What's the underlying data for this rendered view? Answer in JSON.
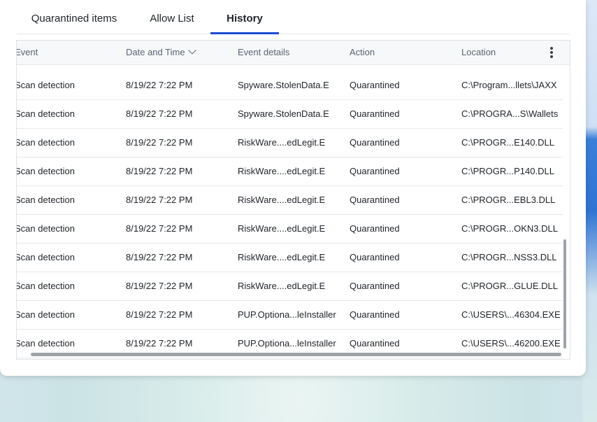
{
  "tabs": [
    {
      "label": "Quarantined items"
    },
    {
      "label": "Allow List"
    },
    {
      "label": "History"
    }
  ],
  "active_tab": "History",
  "columns": [
    "Event",
    "Date and Time",
    "Event details",
    "Action",
    "Location"
  ],
  "sort_column": "Date and Time",
  "rows": [
    {
      "event": "Scan detection",
      "datetime": "8/19/22 7:22 PM",
      "details": "Spyware.StolenData.E",
      "action": "Quarantined",
      "location": "C:\\Program...llets\\JAXX"
    },
    {
      "event": "Scan detection",
      "datetime": "8/19/22 7:22 PM",
      "details": "Spyware.StolenData.E",
      "action": "Quarantined",
      "location": "C:\\PROGRA...S\\Wallets"
    },
    {
      "event": "Scan detection",
      "datetime": "8/19/22 7:22 PM",
      "details": "RiskWare....edLegit.E",
      "action": "Quarantined",
      "location": "C:\\PROGR...E140.DLL"
    },
    {
      "event": "Scan detection",
      "datetime": "8/19/22 7:22 PM",
      "details": "RiskWare....edLegit.E",
      "action": "Quarantined",
      "location": "C:\\PROGR...P140.DLL"
    },
    {
      "event": "Scan detection",
      "datetime": "8/19/22 7:22 PM",
      "details": "RiskWare....edLegit.E",
      "action": "Quarantined",
      "location": "C:\\PROGR...EBL3.DLL"
    },
    {
      "event": "Scan detection",
      "datetime": "8/19/22 7:22 PM",
      "details": "RiskWare....edLegit.E",
      "action": "Quarantined",
      "location": "C:\\PROGR...OKN3.DLL"
    },
    {
      "event": "Scan detection",
      "datetime": "8/19/22 7:22 PM",
      "details": "RiskWare....edLegit.E",
      "action": "Quarantined",
      "location": "C:\\PROGR...NSS3.DLL"
    },
    {
      "event": "Scan detection",
      "datetime": "8/19/22 7:22 PM",
      "details": "RiskWare....edLegit.E",
      "action": "Quarantined",
      "location": "C:\\PROGR...GLUE.DLL"
    },
    {
      "event": "Scan detection",
      "datetime": "8/19/22 7:22 PM",
      "details": "PUP.Optiona...leInstaller",
      "action": "Quarantined",
      "location": "C:\\USERS\\...46304.EXE"
    },
    {
      "event": "Scan detection",
      "datetime": "8/19/22 7:22 PM",
      "details": "PUP.Optiona...leInstaller",
      "action": "Quarantined",
      "location": "C:\\USERS\\...46200.EXE"
    }
  ],
  "icons": {
    "sort": "chevron-down-icon",
    "menu": "more-vertical-icon"
  },
  "colors": {
    "accent": "#1d4bd1"
  }
}
